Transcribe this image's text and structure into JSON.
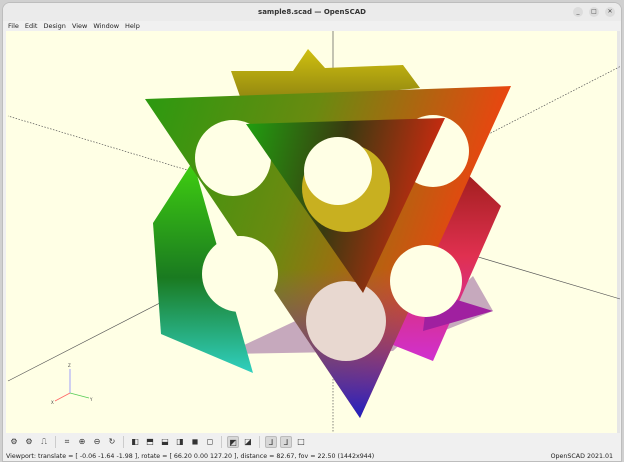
{
  "window": {
    "title": "sample8.scad — OpenSCAD",
    "minimize": "_",
    "maximize": "□",
    "close": "✕"
  },
  "menu": [
    "File",
    "Edit",
    "Design",
    "View",
    "Window",
    "Help"
  ],
  "toolbar": [
    {
      "name": "render-icon",
      "glyph": "⚙"
    },
    {
      "name": "preview-icon",
      "glyph": "⚙"
    },
    {
      "name": "export-stl-icon",
      "glyph": "⎍"
    },
    {
      "name": "view-all-icon",
      "glyph": "⌗"
    },
    {
      "name": "zoom-in-icon",
      "glyph": "⊕"
    },
    {
      "name": "zoom-out-icon",
      "glyph": "⊖"
    },
    {
      "name": "reset-view-icon",
      "glyph": "↻"
    },
    {
      "name": "view-right-icon",
      "glyph": "◧"
    },
    {
      "name": "view-top-icon",
      "glyph": "⬒"
    },
    {
      "name": "view-bottom-icon",
      "glyph": "⬓"
    },
    {
      "name": "view-left-icon",
      "glyph": "◨"
    },
    {
      "name": "view-front-icon",
      "glyph": "◼"
    },
    {
      "name": "view-back-icon",
      "glyph": "◻"
    },
    {
      "name": "perspective-icon",
      "glyph": "◩",
      "active": true
    },
    {
      "name": "orthogonal-icon",
      "glyph": "◪"
    },
    {
      "name": "show-axes-icon",
      "glyph": "⅃",
      "active": true
    },
    {
      "name": "scale-markers-icon",
      "glyph": "⅃",
      "active": true
    },
    {
      "name": "show-edges-icon",
      "glyph": "□"
    }
  ],
  "status": {
    "viewport": "Viewport: translate = [ -0.06 -1.64 -1.98 ], rotate = [ 66.20 0.00 127.20 ], distance = 82.67, fov = 22.50 (1442x944)",
    "version": "OpenSCAD 2021.01"
  },
  "axes": {
    "x": "X",
    "y": "Y",
    "z": "Z"
  },
  "colors": {
    "background": "#ffffe5"
  }
}
